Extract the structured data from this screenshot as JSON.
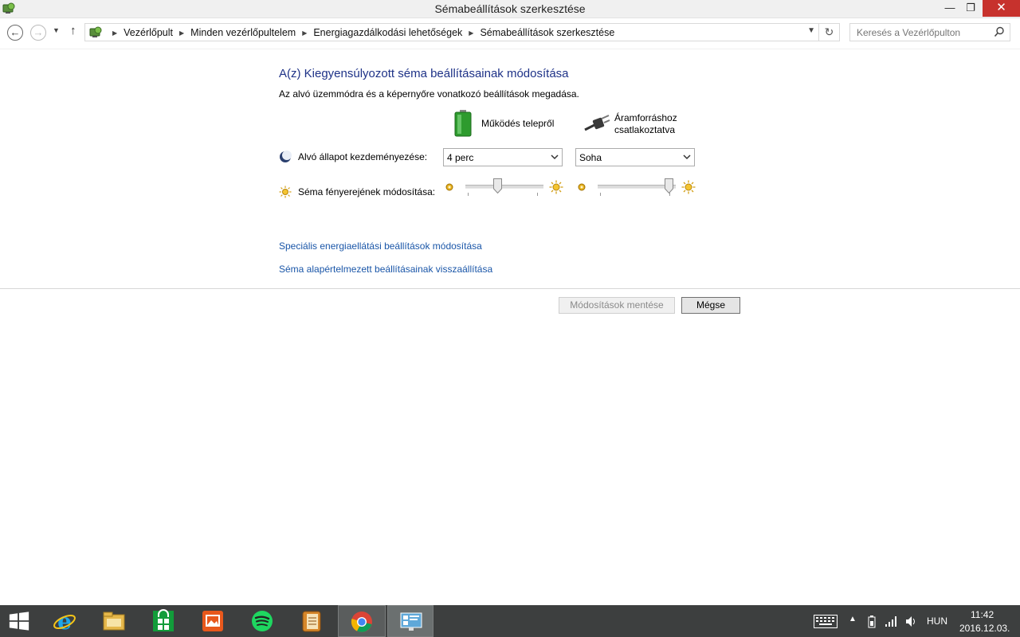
{
  "window": {
    "title": "Sémabeállítások szerkesztése",
    "close_glyph": "✕",
    "min_glyph": "—",
    "restore_glyph": "❐"
  },
  "address": {
    "breadcrumbs": [
      "Vezérlőpult",
      "Minden vezérlőpultelem",
      "Energiagazdálkodási lehetőségek",
      "Sémabeállítások szerkesztése"
    ],
    "search_placeholder": "Keresés a Vezérlőpulton"
  },
  "content": {
    "heading": "A(z) Kiegyensúlyozott séma beállításainak módosítása",
    "subheading": "Az alvó üzemmódra és a képernyőre vonatkozó beállítások megadása.",
    "columns": {
      "battery": "Működés telepről",
      "plugged_line1": "Áramforráshoz",
      "plugged_line2": "csatlakoztatva"
    },
    "sleep": {
      "label": "Alvó állapot kezdeményezése:",
      "battery_value": "4 perc",
      "plugged_value": "Soha"
    },
    "brightness": {
      "label": "Séma fényerejének módosítása:",
      "battery_level": 0.4,
      "plugged_level": 0.96
    },
    "links": {
      "advanced": "Speciális energiaellátási beállítások módosítása",
      "restore": "Séma alapértelmezett beállításainak visszaállítása"
    },
    "buttons": {
      "save": "Módosítások mentése",
      "cancel": "Mégse"
    }
  },
  "taskbar": {
    "apps": [
      "start-icon",
      "internet-explorer-icon",
      "file-explorer-icon",
      "store-icon",
      "photos-icon",
      "spotify-icon",
      "notes-app-icon",
      "chrome-icon",
      "control-panel-icon"
    ],
    "language": "HUN",
    "time": "11:42",
    "date": "2016.12.03."
  },
  "colors": {
    "heading": "#1e3287",
    "link": "#1a56a8",
    "close": "#c7322d",
    "taskbar": "#3d3f3f"
  }
}
